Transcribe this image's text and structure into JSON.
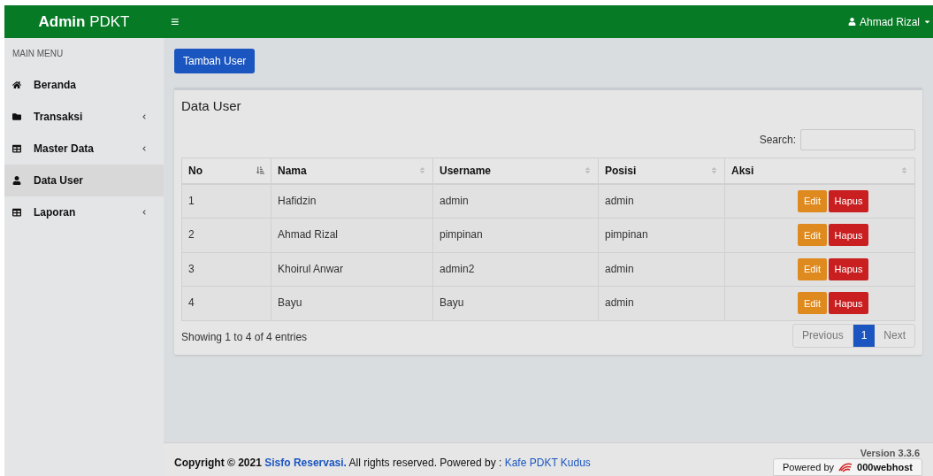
{
  "header": {
    "brand_bold": "Admin",
    "brand_rest": "PDKT",
    "menu_toggle": "≡",
    "user": "Ahmad Rizal"
  },
  "sidebar": {
    "heading": "MAIN MENU",
    "items": [
      {
        "label": "Beranda",
        "selected": false,
        "submenu": false
      },
      {
        "label": "Transaksi",
        "selected": false,
        "submenu": true
      },
      {
        "label": "Master Data",
        "selected": false,
        "submenu": true
      },
      {
        "label": "Data User",
        "selected": true,
        "submenu": false
      },
      {
        "label": "Laporan",
        "selected": false,
        "submenu": true
      }
    ]
  },
  "add_button": "Tambah User",
  "card": {
    "title": "Data User",
    "search_label": "Search:",
    "columns": [
      {
        "label": "No",
        "sorted": true
      },
      {
        "label": "Nama",
        "sorted": false
      },
      {
        "label": "Username",
        "sorted": false
      },
      {
        "label": "Posisi",
        "sorted": false
      },
      {
        "label": "Aksi",
        "sorted": false
      }
    ],
    "rows": [
      {
        "no": "1",
        "nama": "Hafidzin",
        "username": "admin",
        "posisi": "admin",
        "edit": "Edit",
        "delete": "Hapus"
      },
      {
        "no": "2",
        "nama": "Ahmad Rizal",
        "username": "pimpinan",
        "posisi": "pimpinan",
        "edit": "Edit",
        "delete": "Hapus"
      },
      {
        "no": "3",
        "nama": "Khoirul Anwar",
        "username": "admin2",
        "posisi": "admin",
        "edit": "Edit",
        "delete": "Hapus"
      },
      {
        "no": "4",
        "nama": "Bayu",
        "username": "Bayu",
        "posisi": "admin",
        "edit": "Edit",
        "delete": "Hapus"
      }
    ],
    "info": "Showing 1 to 4 of 4 entries",
    "pagination": {
      "previous": "Previous",
      "next": "Next",
      "pages": [
        {
          "label": "1",
          "selected": true
        }
      ]
    }
  },
  "footer": {
    "text": "**Copyright © 2021** ",
    "link": "Sisfo Reservasi.",
    "text2": " All rights reserved. Powered by : ",
    "link2": "Kafe PDKT Kudus",
    "version": "Version 3.3.6",
    "host_prefix": "Powered by",
    "host_name": "000webhost"
  }
}
